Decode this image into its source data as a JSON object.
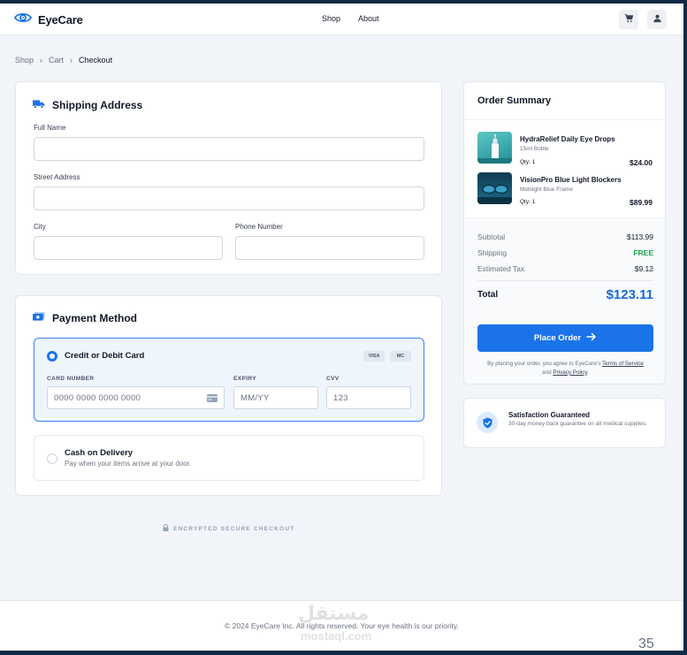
{
  "brand": {
    "name": "EyeCare"
  },
  "nav": {
    "shop": "Shop",
    "about": "About"
  },
  "breadcrumb": {
    "shop": "Shop",
    "cart": "Cart",
    "current": "Checkout"
  },
  "shipping": {
    "title": "Shipping Address",
    "full_name_label": "Full Name",
    "street_label": "Street Address",
    "city_label": "City",
    "phone_label": "Phone Number"
  },
  "payment": {
    "title": "Payment Method",
    "card_option": "Credit or Debit Card",
    "badges": [
      "VISA",
      "MC"
    ],
    "card_number_label": "CARD NUMBER",
    "card_number_placeholder": "0000 0000 0000 0000",
    "expiry_label": "EXPIRY",
    "expiry_placeholder": "MM/YY",
    "cvv_label": "CVV",
    "cvv_placeholder": "123",
    "cod_option": "Cash on Delivery",
    "cod_sub": "Pay when your items arrive at your door."
  },
  "secure_note": "ENCRYPTED SECURE CHECKOUT",
  "summary": {
    "title": "Order Summary",
    "items": [
      {
        "name": "HydraRelief Daily Eye Drops",
        "variant": "15ml Bottle",
        "qty": "Qty: 1",
        "price": "$24.00"
      },
      {
        "name": "VisionPro Blue Light Blockers",
        "variant": "Midnight Blue Frame",
        "qty": "Qty: 1",
        "price": "$89.99"
      }
    ],
    "subtotal_label": "Subtotal",
    "subtotal": "$113.99",
    "shipping_label": "Shipping",
    "shipping": "FREE",
    "tax_label": "Estimated Tax",
    "tax": "$9.12",
    "total_label": "Total",
    "total": "$123.11",
    "place_order": "Place Order",
    "terms_prefix": "By placing your order, you agree to EyeCare's",
    "terms_link": "Terms of Service",
    "terms_and": "and",
    "privacy_link": "Privacy Policy",
    "terms_suffix": "."
  },
  "guarantee": {
    "title": "Satisfaction Guaranteed",
    "text": "30-day money back guarantee on all medical supplies."
  },
  "footer": {
    "copyright": "© 2024 EyeCare Inc. All rights reserved. Your eye health is our priority."
  },
  "watermark": {
    "arabic": "مستقل",
    "latin": "mostaql.com"
  },
  "page_number": "35",
  "colors": {
    "accent": "#1a73e8",
    "free": "#16a34a",
    "total": "#1668d8"
  }
}
